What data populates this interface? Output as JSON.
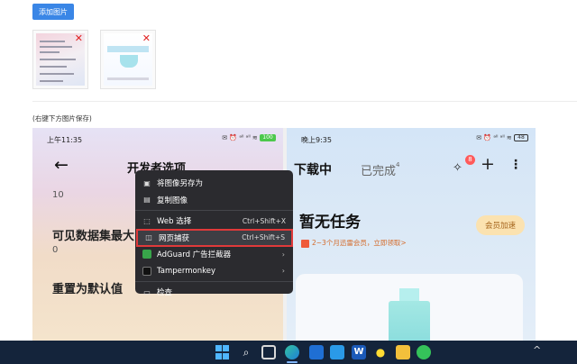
{
  "toolbar": {
    "add_image_label": "添加图片"
  },
  "thumbs": [
    {
      "remove_label": "✕"
    },
    {
      "remove_label": "✕"
    }
  ],
  "caption": "(右键下方图片保存)",
  "left_phone": {
    "status_time": "上午11:35",
    "status_icons": "✉ ⏰ ᵃˡˡ ᵃˡˡ ≋",
    "battery": "100",
    "title": "开发者选项",
    "value_10": "10",
    "label_visible": "可见数据集最大",
    "value_0": "0",
    "label_reset": "重置为默认值"
  },
  "right_phone": {
    "status_time": "晚上9:35",
    "status_icons": "✉ ⏰ ᵃˡˡ ᵃˡˡ ≋",
    "battery": "48",
    "tab_downloading": "下载中",
    "tab_done": "已完成",
    "tab_done_count": "4",
    "badge_count": "8",
    "plus": "+",
    "no_task": "暂无任务",
    "vip_button": "会员加速",
    "promo": "2~3个月迅雷会员，立即领取>"
  },
  "context_menu": {
    "items": [
      {
        "label": "将图像另存为",
        "shortcut": ""
      },
      {
        "label": "复制图像",
        "shortcut": ""
      },
      {
        "label": "Web 选择",
        "shortcut": "Ctrl+Shift+X"
      },
      {
        "label": "网页捕获",
        "shortcut": "Ctrl+Shift+S"
      },
      {
        "label": "AdGuard 广告拦截器",
        "shortcut": ""
      },
      {
        "label": "Tampermonkey",
        "shortcut": ""
      },
      {
        "label": "检查",
        "shortcut": ""
      }
    ],
    "highlighted_index": 3,
    "highlight_color": "#e03a3a"
  },
  "taskbar": {
    "icons": [
      "windows-start-icon",
      "search-icon",
      "task-view-icon",
      "edge-icon",
      "mail-icon",
      "app-icon",
      "word-icon",
      "qq-icon",
      "file-explorer-icon",
      "wechat-icon"
    ],
    "word_letter": "W",
    "tray_chevron": "^"
  },
  "colors": {
    "accent": "#3a86e6",
    "taskbar": "#14243b",
    "menu_bg": "#2b2b2f"
  }
}
